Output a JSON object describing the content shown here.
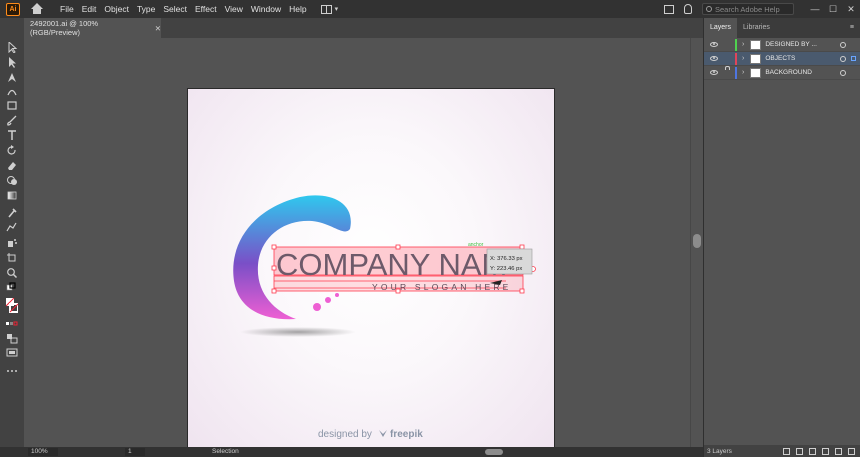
{
  "menubar": {
    "app_logo": "Ai",
    "items": [
      "File",
      "Edit",
      "Object",
      "Type",
      "Select",
      "Effect",
      "View",
      "Window",
      "Help"
    ],
    "search_placeholder": "Search Adobe Help",
    "window_controls": [
      "—",
      "☐",
      "✕"
    ]
  },
  "document": {
    "tab_title": "2492001.ai @ 100% (RGB/Preview)",
    "tab_close": "✕"
  },
  "artwork": {
    "company_text": "COMPANY NAM",
    "slogan_text": "YOUR SLOGAN HERE",
    "smart_guide_hint": "anchor",
    "coord_x": "X: 376.33 px",
    "coord_y": "Y: 223.46 px",
    "watermark_prefix": "designed by",
    "watermark_brand": "freepik",
    "colors": {
      "swoosh_cyan": "#2fc8ee",
      "swoosh_purple": "#7a4fc7",
      "swoosh_pink": "#ee5fd3",
      "company_text": "#6d5a6a",
      "selection": "#ff3a4e"
    }
  },
  "statusbar": {
    "zoom": "100%",
    "page": "1",
    "tool_label": "Selection"
  },
  "layers_panel": {
    "tabs": [
      "Layers",
      "Libraries"
    ],
    "menu_icon": "≡",
    "layers": [
      {
        "name": "DESIGNED BY ...",
        "color": "#4fd14f",
        "locked": false,
        "selected": false
      },
      {
        "name": "OBJECTS",
        "color": "#e0455a",
        "locked": false,
        "selected": true
      },
      {
        "name": "BACKGROUND",
        "color": "#4f76e0",
        "locked": true,
        "selected": false
      }
    ],
    "layer_count": "3 Layers"
  }
}
